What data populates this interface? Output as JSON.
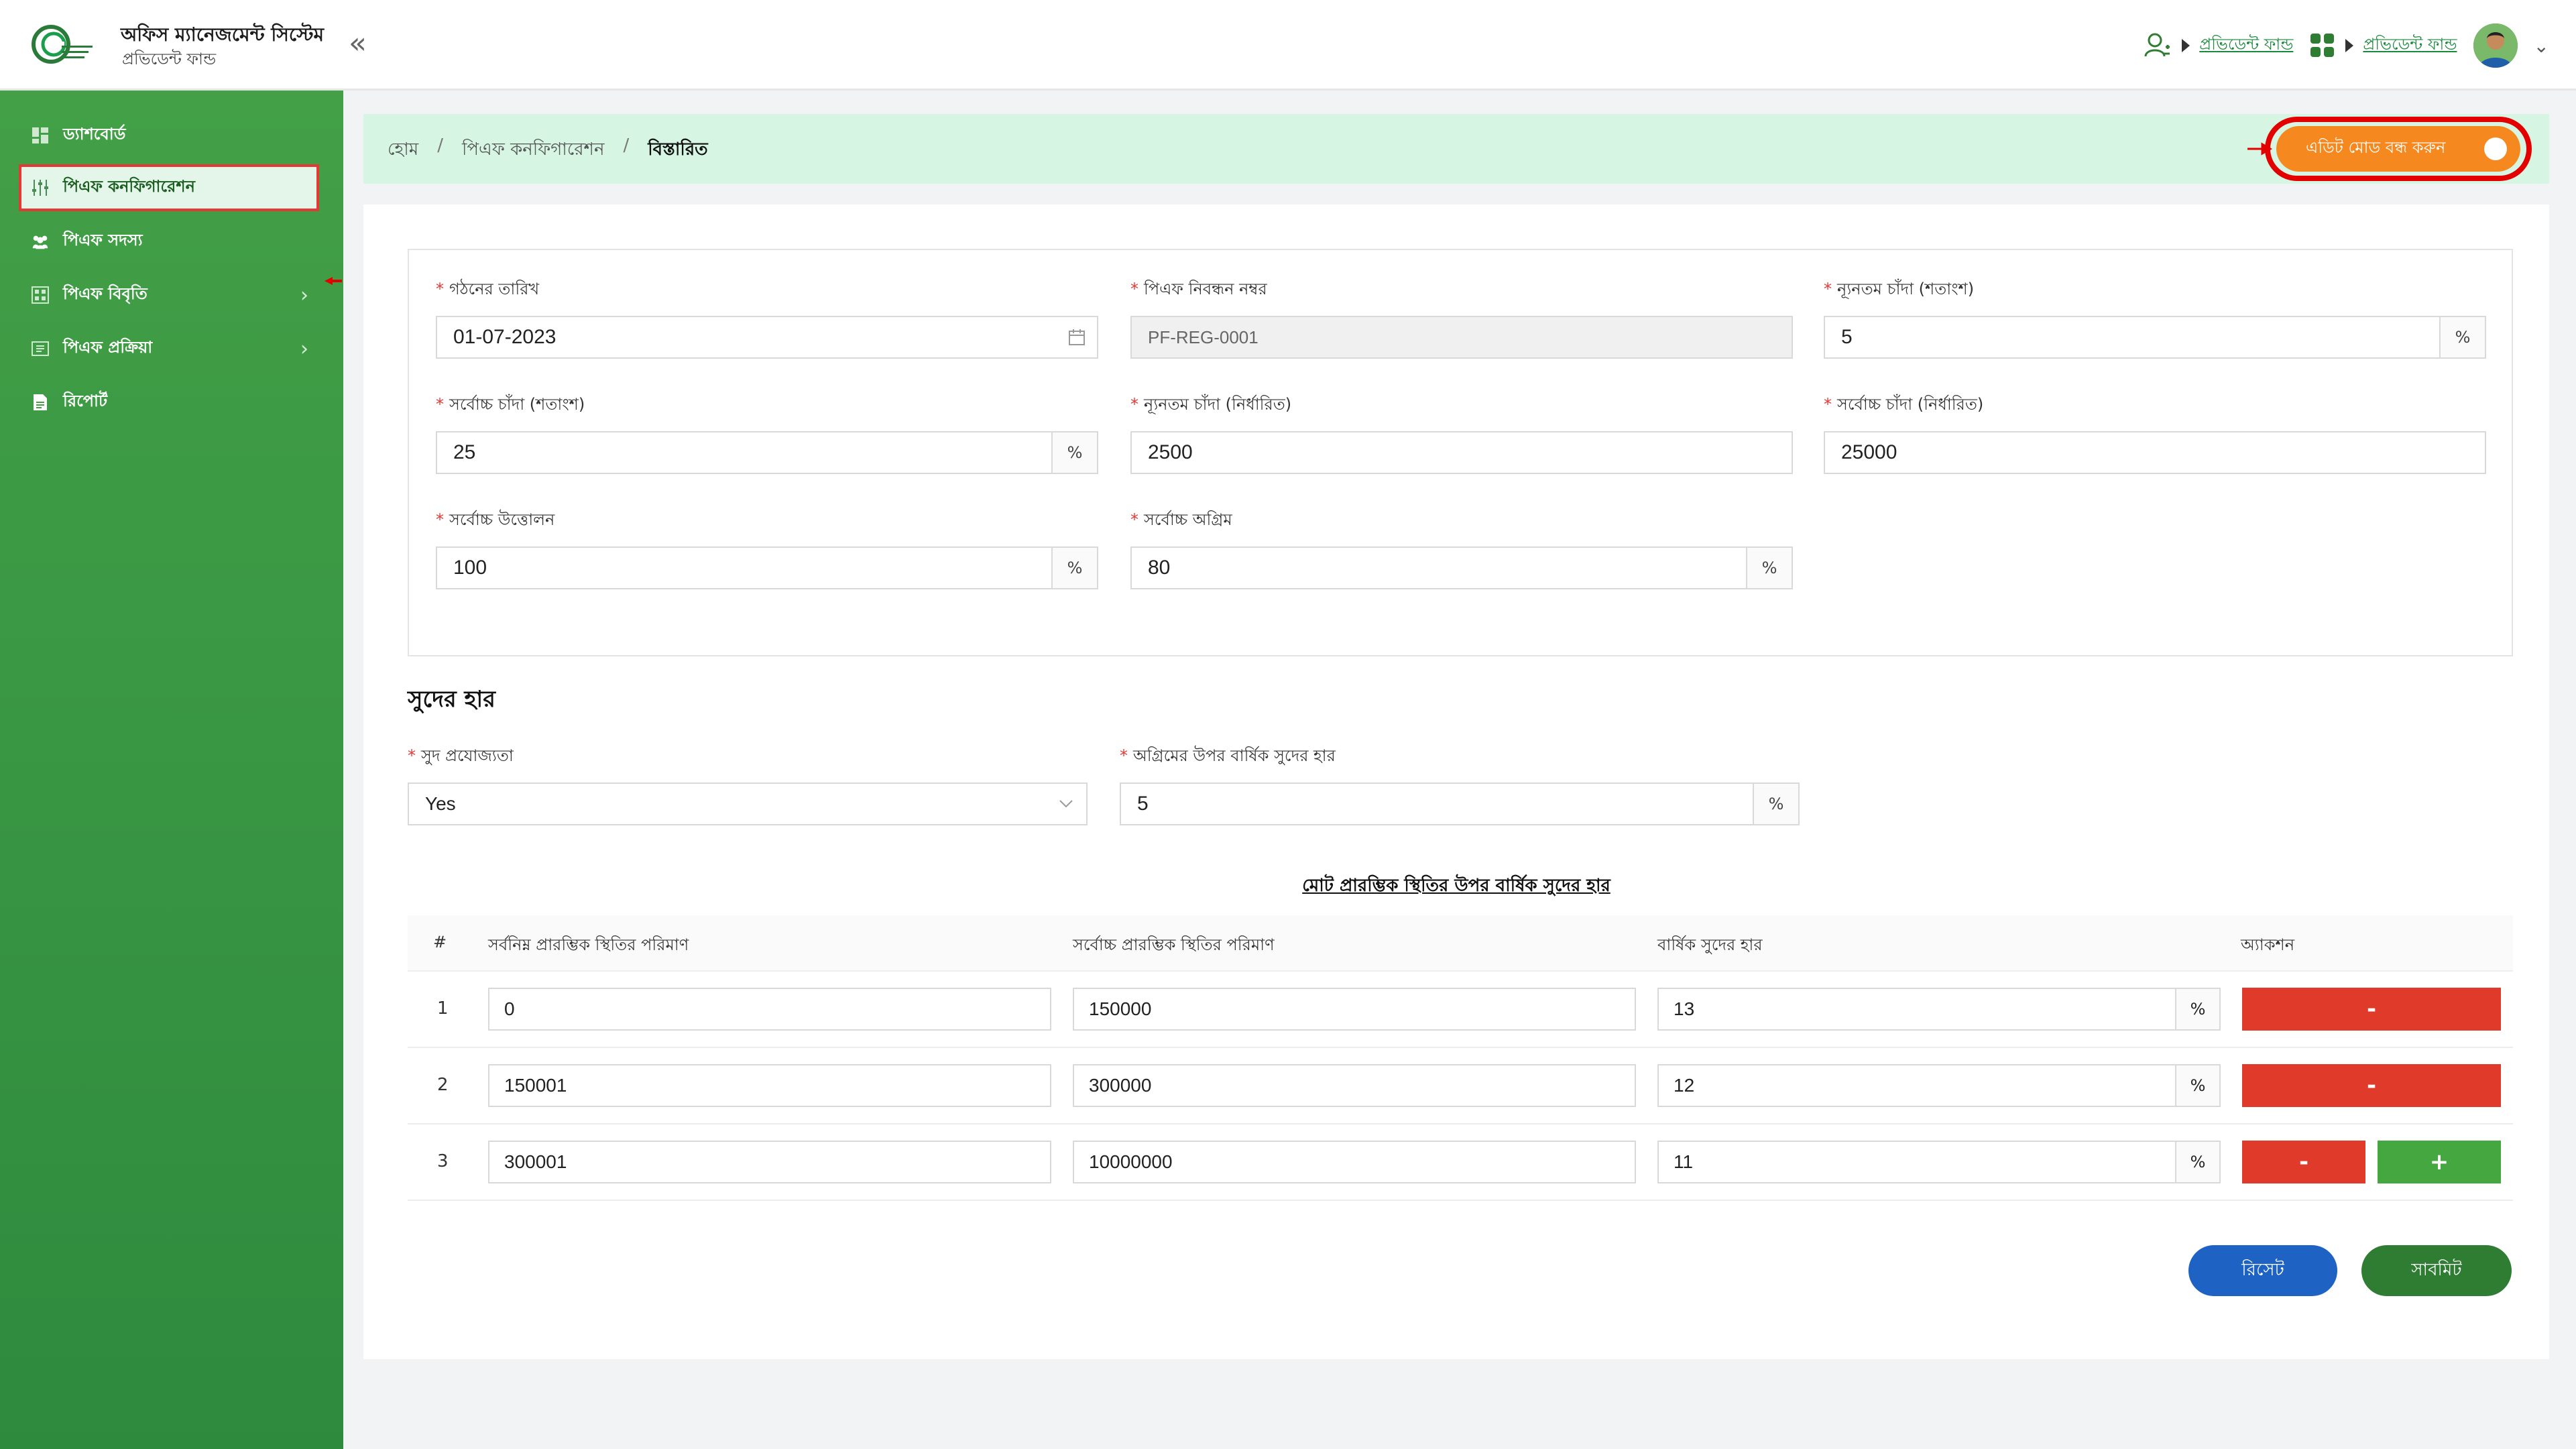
{
  "header": {
    "brand_title": "অফিস ম্যানেজমেন্ট সিস্টেম",
    "brand_sub": "প্রভিডেন্ট ফান্ড",
    "collapse_glyph": "«",
    "links": [
      {
        "label": "প্রভিডেন্ট ফান্ড"
      },
      {
        "label": "প্রভিডেন্ট ফান্ড"
      }
    ],
    "chevron": "⌄"
  },
  "sidebar": {
    "items": [
      {
        "label": "ড্যাশবোর্ড",
        "icon": "dashboard-icon"
      },
      {
        "label": "পিএফ কনফিগারেশন",
        "icon": "sliders-icon",
        "active": true
      },
      {
        "label": "পিএফ সদস্য",
        "icon": "users-icon"
      },
      {
        "label": "পিএফ বিবৃতি",
        "icon": "statement-icon",
        "has_children": true
      },
      {
        "label": "পিএফ প্রক্রিয়া",
        "icon": "process-icon",
        "has_children": true
      },
      {
        "label": "রিপোর্ট",
        "icon": "report-icon"
      }
    ],
    "arrow_glyph": "›"
  },
  "breadcrumb": {
    "home": "হোম",
    "section": "পিএফ কনফিগারেশন",
    "current": "বিস্তারিত",
    "separator": "/"
  },
  "edit_mode_button": {
    "label": "এডিট মোড বন্ধ করুন"
  },
  "form": {
    "formation_date": {
      "label": "গঠনের তারিখ",
      "value": "01-07-2023"
    },
    "pf_reg_no": {
      "label": "পিএফ নিবন্ধন নম্বর",
      "value": "PF-REG-0001"
    },
    "min_contrib_percent": {
      "label": "ন্যূনতম চাঁদা (শতাংশ)",
      "value": "5",
      "suffix": "%"
    },
    "max_contrib_percent": {
      "label": "সর্বোচ্চ চাঁদা (শতাংশ)",
      "value": "25",
      "suffix": "%"
    },
    "min_contrib_fixed": {
      "label": "ন্যূনতম চাঁদা (নির্ধারিত)",
      "value": "2500"
    },
    "max_contrib_fixed": {
      "label": "সর্বোচ্চ চাঁদা (নির্ধারিত)",
      "value": "25000"
    },
    "max_withdrawal": {
      "label": "সর্বোচ্চ উত্তোলন",
      "value": "100",
      "suffix": "%"
    },
    "max_advance": {
      "label": "সর্বোচ্চ অগ্রিম",
      "value": "80",
      "suffix": "%"
    },
    "required_mark": "*"
  },
  "interest": {
    "title": "সুদের হার",
    "applicable": {
      "label": "সুদ প্রযোজ্যতা",
      "value": "Yes"
    },
    "advance_rate": {
      "label": "অগ্রিমের উপর বার্ষিক সুদের হার",
      "value": "5",
      "suffix": "%"
    },
    "table_caption": "মোট প্রারম্ভিক স্থিতির উপর বার্ষিক সুদের হার",
    "columns": [
      "#",
      "সর্বনিম্ন প্রারম্ভিক স্থিতির পরিমাণ",
      "সর্বোচ্চ প্রারম্ভিক স্থিতির পরিমাণ",
      "বার্ষিক সুদের হার",
      "অ্যাকশন"
    ],
    "rows": [
      {
        "n": "1",
        "min": "0",
        "max": "150000",
        "rate": "13"
      },
      {
        "n": "2",
        "min": "150001",
        "max": "300000",
        "rate": "12"
      },
      {
        "n": "3",
        "min": "300001",
        "max": "10000000",
        "rate": "11"
      }
    ],
    "rate_suffix": "%",
    "minus_label": "-",
    "plus_label": "+"
  },
  "actions": {
    "reset": "রিসেট",
    "submit": "সাবমিট"
  },
  "colors": {
    "sidebar": "#43a047",
    "accent_orange": "#f5891f",
    "highlight_red": "#e30000",
    "danger": "#e03a2a",
    "success": "#44a73f",
    "primary_blue": "#1e63c3"
  }
}
